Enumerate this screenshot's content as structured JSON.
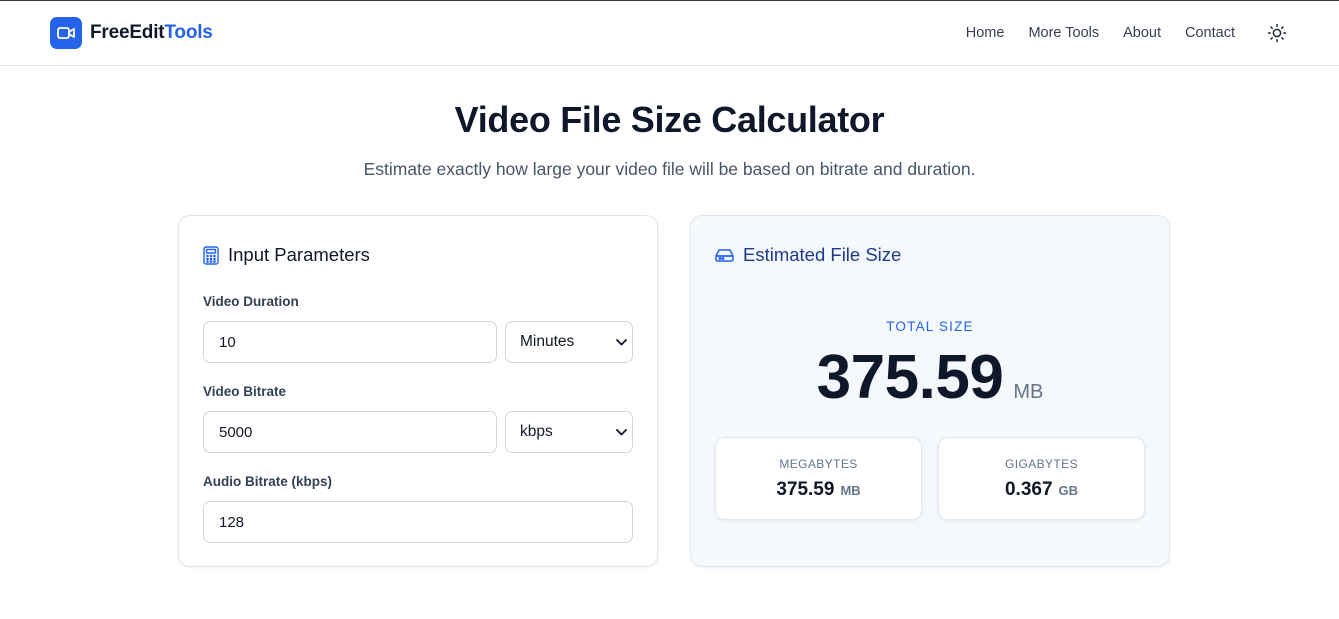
{
  "header": {
    "brand_part1": "FreeEdit",
    "brand_part2": "Tools",
    "brand_icon": "video-camera-icon",
    "nav": [
      {
        "label": "Home"
      },
      {
        "label": "More Tools"
      },
      {
        "label": "About"
      },
      {
        "label": "Contact"
      }
    ],
    "theme_icon": "sun-icon"
  },
  "hero": {
    "title": "Video File Size Calculator",
    "subtitle": "Estimate exactly how large your video file will be based on bitrate and duration."
  },
  "input_card": {
    "title": "Input Parameters",
    "icon": "calculator-icon",
    "duration_label": "Video Duration",
    "duration_value": "10",
    "duration_unit": "Minutes",
    "video_bitrate_label": "Video Bitrate",
    "video_bitrate_value": "5000",
    "video_bitrate_unit": "kbps",
    "audio_bitrate_label": "Audio Bitrate (kbps)",
    "audio_bitrate_value": "128"
  },
  "result_card": {
    "title": "Estimated File Size",
    "icon": "hard-drive-icon",
    "total_label": "TOTAL SIZE",
    "total_value": "375.59",
    "total_unit": "MB",
    "megabytes_label": "MEGABYTES",
    "megabytes_value": "375.59",
    "megabytes_unit": "MB",
    "gigabytes_label": "GIGABYTES",
    "gigabytes_value": "0.367",
    "gigabytes_unit": "GB"
  },
  "colors": {
    "accent": "#2563eb",
    "text_dark": "#0f172a",
    "muted": "#64748b",
    "result_bg": "#f5f8fc"
  }
}
